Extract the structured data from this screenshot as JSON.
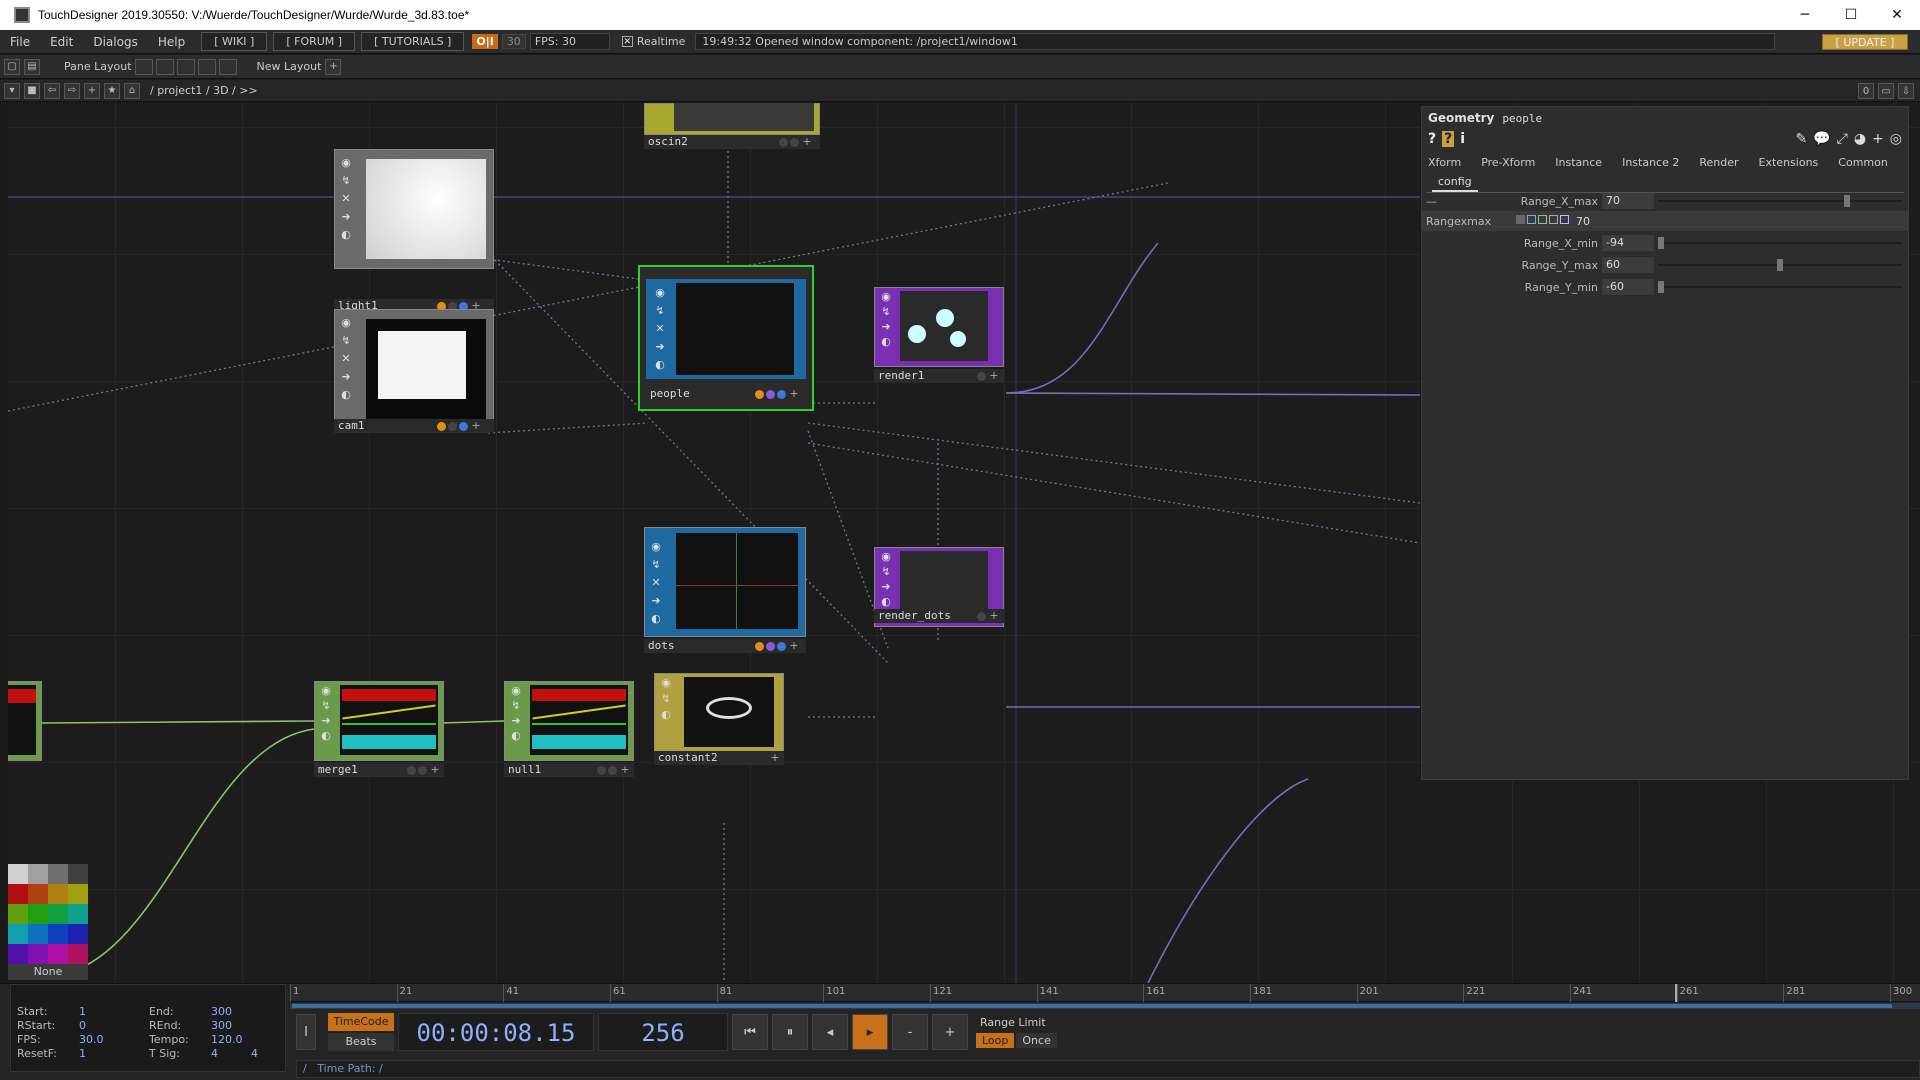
{
  "window": {
    "title": "TouchDesigner 2019.30550: V:/Wuerde/TouchDesigner/Wurde/Wurde_3d.83.toe*",
    "minimize": "─",
    "maximize": "☐",
    "close": "✕"
  },
  "menubar": {
    "items": [
      "File",
      "Edit",
      "Dialogs",
      "Help"
    ],
    "wiki": "[ WIKI ]",
    "forum": "[ FORUM ]",
    "tutorials": "[ TUTORIALS ]",
    "oi": "O|I",
    "fps_setting": "30",
    "fps_readout": "FPS:  30",
    "realtime_label": "Realtime",
    "realtime_check": "✕",
    "message": "19:49:32 Opened window component: /project1/window1",
    "update": "[ UPDATE ]"
  },
  "panebar": {
    "pane_layout": "Pane Layout",
    "new_layout": "New Layout",
    "add": "+"
  },
  "pathbar": {
    "path": "/  project1  /  3D  /  >>",
    "right_zero": "0"
  },
  "nodes": {
    "oscin2": "oscin2",
    "light1": "light1",
    "cam1": "cam1",
    "people": "people",
    "render1": "render1",
    "render_dots": "render_dots",
    "merge1": "merge1",
    "null1": "null1",
    "dots": "dots",
    "constant2": "constant2"
  },
  "palette": {
    "none": "None",
    "colors": [
      "#d0d0d0",
      "#a0a0a0",
      "#707070",
      "#404040",
      "#b01010",
      "#b04010",
      "#b08010",
      "#a0a010",
      "#60a010",
      "#20a010",
      "#10a040",
      "#10a090",
      "#10a0b0",
      "#1070c0",
      "#1040c0",
      "#2020b0",
      "#5010b0",
      "#8010b0",
      "#b010a0",
      "#b01060"
    ]
  },
  "params": {
    "type": "Geometry",
    "name": "people",
    "tabs": [
      "Xform",
      "Pre-Xform",
      "Instance",
      "Instance 2",
      "Render",
      "Extensions",
      "Common"
    ],
    "subtab": "config",
    "section_dash": "—",
    "rangexmax_label": "Rangexmax",
    "rangexmax_value": "70",
    "rows": [
      {
        "label": "Range_X_max",
        "value": "70",
        "pos": 0.78
      },
      {
        "label": "Range_X_min",
        "value": "-94",
        "pos": 0.0
      },
      {
        "label": "Range_Y_max",
        "value": "60",
        "pos": 0.5
      },
      {
        "label": "Range_Y_min",
        "value": "-60",
        "pos": 0.0
      }
    ]
  },
  "timeline": {
    "ticks": [
      "1",
      "21",
      "41",
      "61",
      "81",
      "101",
      "121",
      "141",
      "161",
      "181",
      "201",
      "221",
      "241",
      "261",
      "281",
      "300"
    ],
    "stats": {
      "start_k": "Start:",
      "start_v": "1",
      "end_k": "End:",
      "end_v": "300",
      "rstart_k": "RStart:",
      "rstart_v": "0",
      "rend_k": "REnd:",
      "rend_v": "300",
      "fps_k": "FPS:",
      "fps_v": "30.0",
      "tempo_k": "Tempo:",
      "tempo_v": "120.0",
      "resetf_k": "ResetF:",
      "resetf_v": "1",
      "tsig_k": "T Sig:",
      "tsig_v1": "4",
      "tsig_v2": "4"
    },
    "timecode": "TimeCode",
    "beats": "Beats",
    "time": "00:00:08.15",
    "frame": "256",
    "range_limit": "Range Limit",
    "loop": "Loop",
    "once": "Once",
    "time_path": "Time Path: /",
    "slash": "/",
    "ibeam": "I",
    "minus": "-",
    "plus": "+"
  }
}
